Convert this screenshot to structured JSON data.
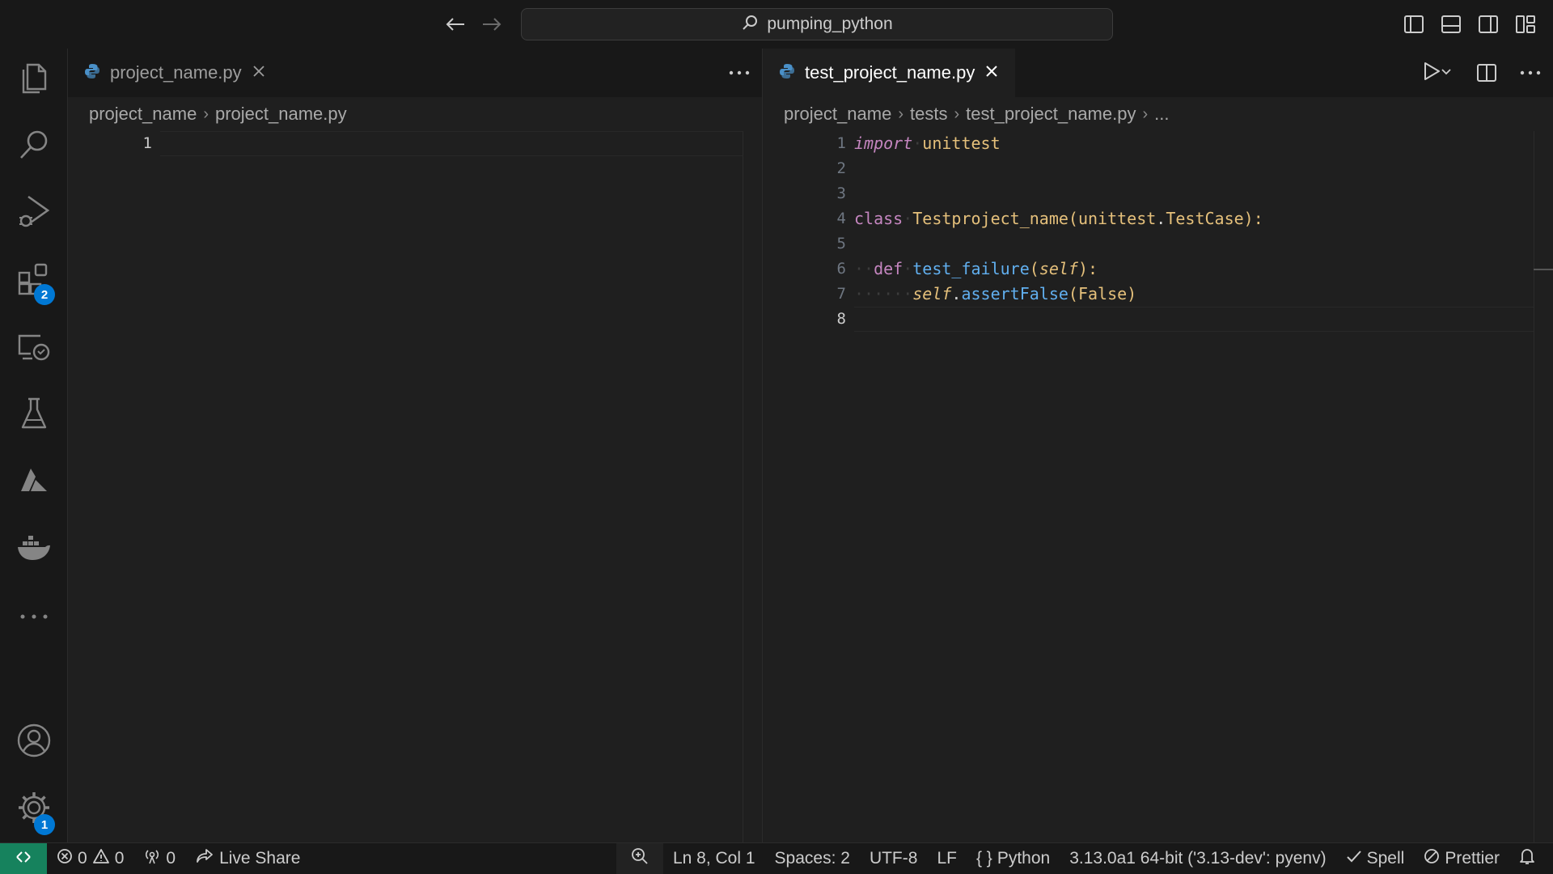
{
  "titlebar": {
    "search_text": "pumping_python",
    "nav_icons": [
      "arrow-left-icon",
      "arrow-right-icon"
    ],
    "layout_icons": [
      "toggle-primary-sidebar-icon",
      "toggle-panel-icon",
      "toggle-secondary-sidebar-icon",
      "customize-layout-icon"
    ]
  },
  "activitybar": {
    "items": [
      {
        "name": "explorer",
        "icon": "files-icon"
      },
      {
        "name": "search",
        "icon": "search-icon"
      },
      {
        "name": "run-and-debug",
        "icon": "debug-icon"
      },
      {
        "name": "extensions",
        "icon": "extensions-icon",
        "badge": "2"
      },
      {
        "name": "remote-explorer",
        "icon": "remote-explorer-icon"
      },
      {
        "name": "testing",
        "icon": "beaker-icon"
      },
      {
        "name": "azure",
        "icon": "azure-icon"
      },
      {
        "name": "docker",
        "icon": "docker-icon"
      },
      {
        "name": "more",
        "icon": "ellipsis-icon"
      }
    ],
    "bottom": [
      {
        "name": "accounts",
        "icon": "account-icon"
      },
      {
        "name": "manage",
        "icon": "gear-icon",
        "badge": "1"
      }
    ]
  },
  "left_group": {
    "tab": {
      "label": "project_name.py",
      "icon": "python-icon"
    },
    "actions_icon": "ellipsis-icon",
    "breadcrumb": [
      "project_name",
      "project_name.py"
    ],
    "lines": [
      "1"
    ]
  },
  "right_group": {
    "tab": {
      "label": "test_project_name.py",
      "icon": "python-icon"
    },
    "actions_icons": [
      "run-icon",
      "chevron-down-icon",
      "split-editor-icon",
      "ellipsis-icon"
    ],
    "breadcrumb": [
      "project_name",
      "tests",
      "test_project_name.py",
      "..."
    ],
    "lines": [
      "1",
      "2",
      "3",
      "4",
      "5",
      "6",
      "7",
      "8"
    ],
    "current_line": "8",
    "code": {
      "l1_kw": "import",
      "l1_mod": "unittest",
      "l4_kw": "class",
      "l4_name": "Testproject_name",
      "l4_open": "(",
      "l4_base1": "unittest",
      "l4_dot": ".",
      "l4_base2": "TestCase",
      "l4_close": "):",
      "l6_kw": "def",
      "l6_name": "test_failure",
      "l6_open": "(",
      "l6_self": "self",
      "l6_close": "):",
      "l7_self": "self",
      "l7_dot": ".",
      "l7_call": "assertFalse",
      "l7_args": "(False)"
    }
  },
  "statusbar": {
    "remote_icon": "remote-icon",
    "errors": "0",
    "warnings": "0",
    "ports": "0",
    "live_share": "Live Share",
    "zoom_icon": "zoom-icon",
    "cursor": "Ln 8, Col 1",
    "indent": "Spaces: 2",
    "encoding": "UTF-8",
    "eol": "LF",
    "language_icon": "{ }",
    "language": "Python",
    "interpreter": "3.13.0a1 64-bit ('3.13-dev': pyenv)",
    "spell": "Spell",
    "prettier": "Prettier",
    "bell_icon": "bell-icon"
  },
  "colors": {
    "accent_badge": "#0078d4",
    "remote_bg": "#16825d",
    "keyword": "#c586c0",
    "class_name": "#e5c07b",
    "function_name": "#61afef"
  }
}
